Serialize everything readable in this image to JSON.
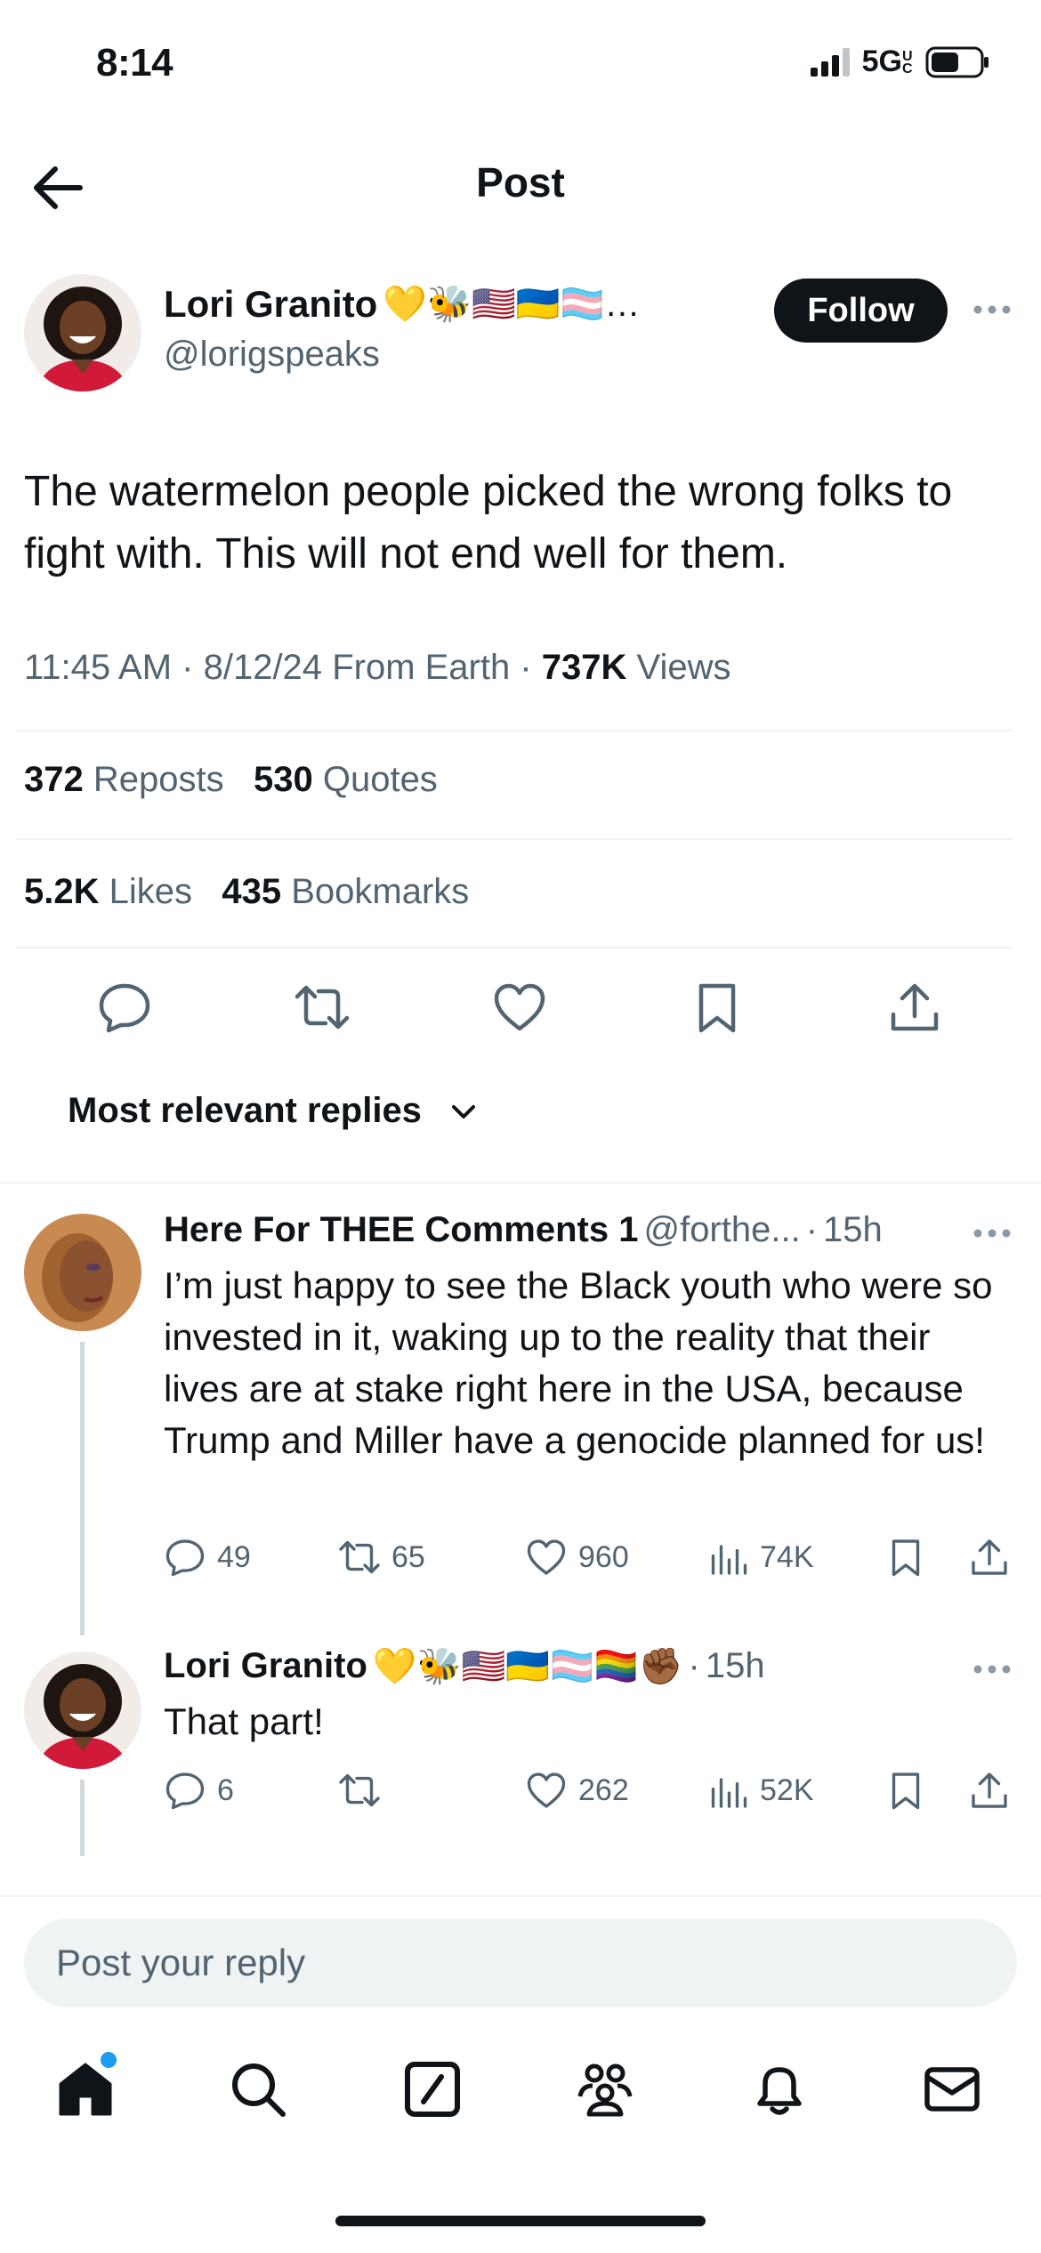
{
  "status_bar": {
    "time": "8:14",
    "network": "5G",
    "network_suffix": "UC"
  },
  "header": {
    "title": "Post"
  },
  "post": {
    "author_name": "Lori Granito",
    "author_badges": "💛🐝🇺🇸🇺🇦🏳️‍⚧️…",
    "handle": "@lorigspeaks",
    "follow_label": "Follow",
    "text": "The watermelon people picked the wrong folks to fight with. This will not end well for them.",
    "time": "11:45 AM",
    "date": "8/12/24",
    "source": "From Earth",
    "views_count": "737K",
    "views_label": "Views",
    "reposts_count": "372",
    "reposts_label": "Reposts",
    "quotes_count": "530",
    "quotes_label": "Quotes",
    "likes_count": "5.2K",
    "likes_label": "Likes",
    "bookmarks_count": "435",
    "bookmarks_label": "Bookmarks"
  },
  "sort": {
    "label": "Most relevant replies"
  },
  "replies": [
    {
      "name": "Here For THEE Comments 1",
      "handle": "@forthe...",
      "time": "15h",
      "text": "I’m just happy to see the Black youth who were so invested in it, waking up to the reality that their lives are at stake right here in the USA, because Trump and Miller have a genocide planned for us!",
      "replies": "49",
      "reposts": "65",
      "likes": "960",
      "views": "74K"
    },
    {
      "name": "Lori Granito",
      "badges": "💛🐝🇺🇸🇺🇦🏳️‍⚧️🏳️‍🌈✊🏾",
      "time": "15h",
      "text": "That part!",
      "replies": "6",
      "reposts": "",
      "likes": "262",
      "views": "52K"
    }
  ],
  "composer": {
    "placeholder": "Post your reply"
  },
  "colors": {
    "accent": "#1d9bf0",
    "text": "#0f1419",
    "muted": "#536471"
  }
}
